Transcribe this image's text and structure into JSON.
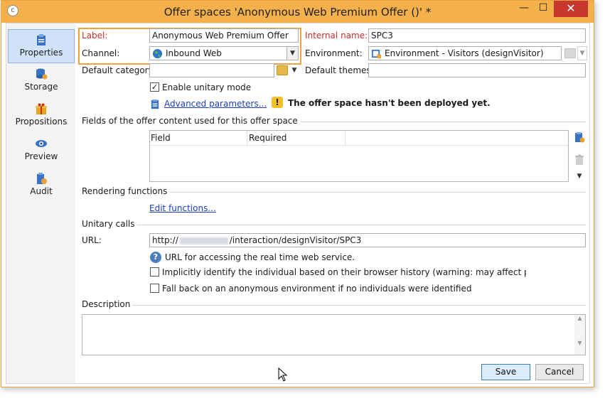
{
  "window": {
    "title": "Offer spaces 'Anonymous Web Premium Offer ()' *",
    "minimize_glyph": "—",
    "maximize_glyph": "☐",
    "close_glyph": "✕",
    "app_icon": "app-icon"
  },
  "sidebar": {
    "items": [
      {
        "label": "Properties",
        "icon": "clipboard-icon",
        "active": true
      },
      {
        "label": "Storage",
        "icon": "database-icon",
        "active": false
      },
      {
        "label": "Propositions",
        "icon": "gift-icon",
        "active": false
      },
      {
        "label": "Preview",
        "icon": "eye-icon",
        "active": false
      },
      {
        "label": "Audit",
        "icon": "audit-icon",
        "active": false
      }
    ]
  },
  "form": {
    "label_label": "Label:",
    "label_value": "Anonymous Web Premium Offer",
    "channel_label": "Channel:",
    "channel_value": "Inbound Web",
    "internal_name_label": "Internal name:",
    "internal_name_value": "SPC3",
    "environment_label": "Environment:",
    "environment_value": "Environment - Visitors (designVisitor)",
    "default_category_label": "Default category:",
    "default_category_value": "",
    "default_themes_label": "Default themes:",
    "default_themes_value": "",
    "enable_unitary_label": "Enable unitary mode",
    "enable_unitary_checked": true,
    "advanced_parameters": "Advanced parameters...",
    "not_deployed_warning": "The offer space hasn't been deployed yet."
  },
  "fields_section": {
    "title": "Fields of the offer content used for this offer space",
    "columns": [
      "Field",
      "Required"
    ],
    "rows": []
  },
  "rendering": {
    "title": "Rendering functions",
    "edit_link": "Edit functions..."
  },
  "unitary_calls": {
    "title": "Unitary calls",
    "url_label": "URL:",
    "url_prefix": "http://",
    "url_suffix": "/interaction/designVisitor/SPC3",
    "url_help": "URL for accessing the real time web service.",
    "implicit_identify_label": "Implicitly identify the individual based on their browser history (warning: may affect performance",
    "fallback_label": "Fall back on an anonymous environment if no individuals were identified"
  },
  "description": {
    "title": "Description",
    "value": ""
  },
  "footer": {
    "save_label": "Save",
    "cancel_label": "Cancel"
  },
  "colors": {
    "title_bar": "#f4b04a",
    "close_button": "#c7372d",
    "required_label": "#c8302b",
    "link": "#1a3fb5",
    "highlight": "#f2a23c",
    "selected_sidebar": "#cfe2f7"
  }
}
